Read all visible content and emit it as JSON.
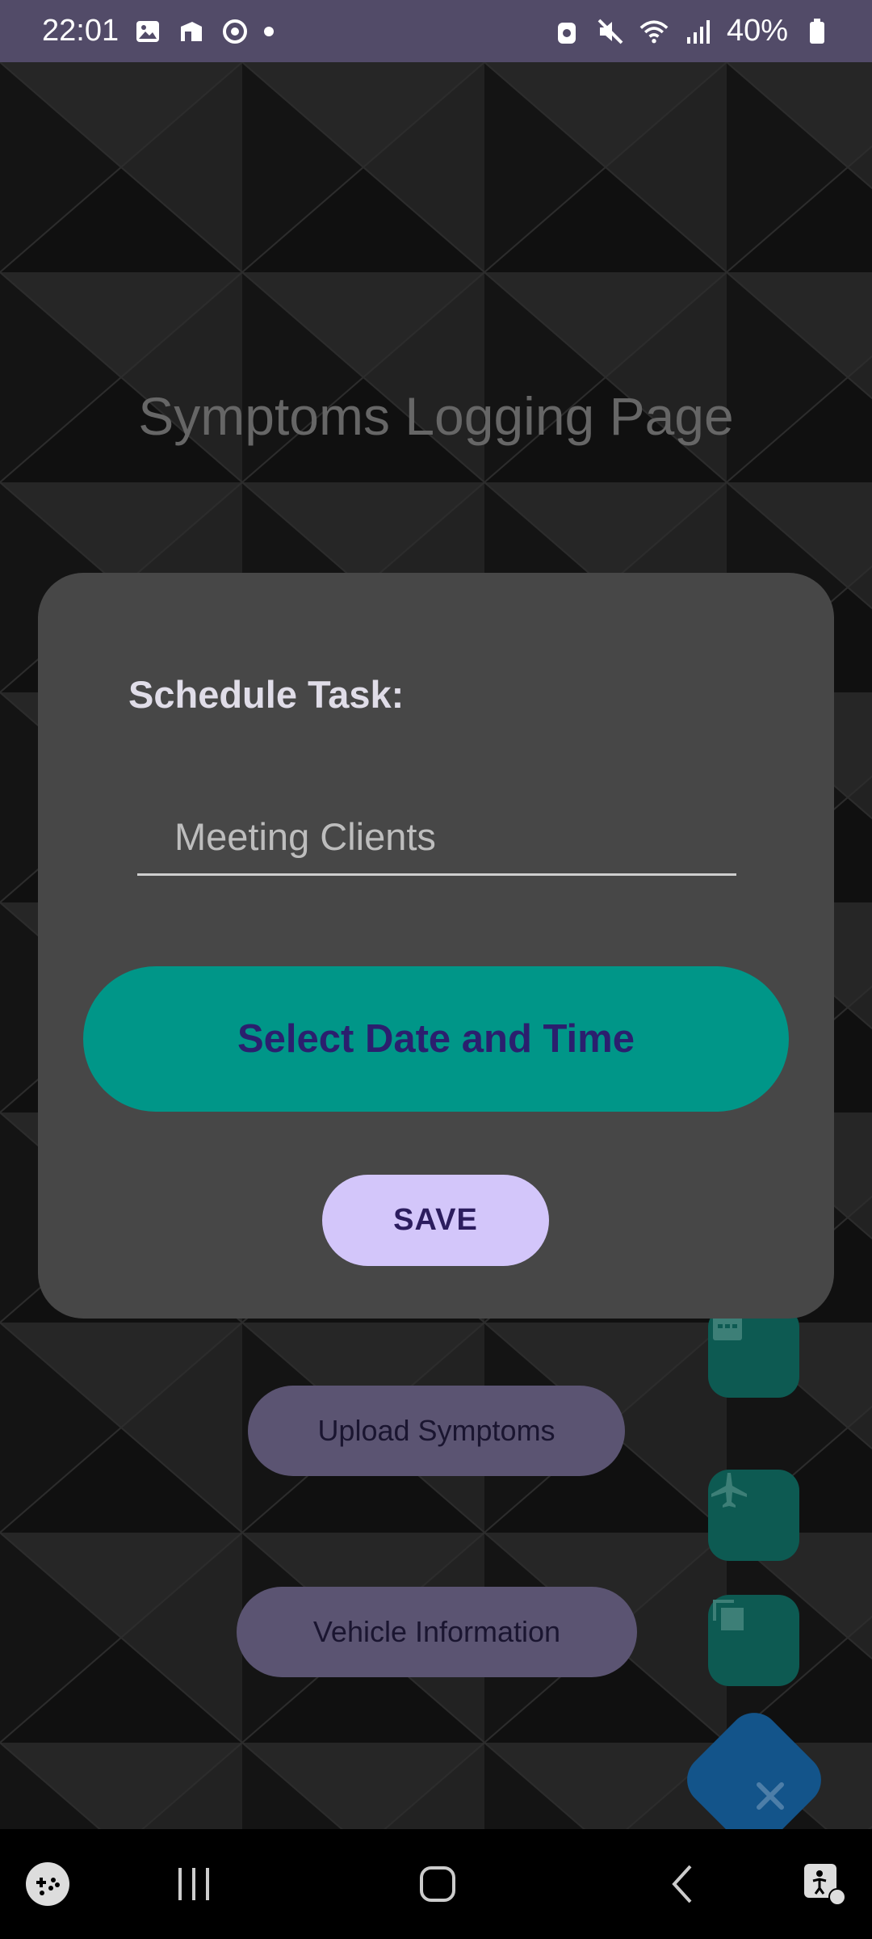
{
  "status_bar": {
    "time": "22:01",
    "battery": "40%",
    "left_icons": [
      "image-icon",
      "cast-icon",
      "screen-record-icon",
      "dot-icon"
    ],
    "right_icons": [
      "alarm-icon",
      "mute-icon",
      "wifi-icon",
      "signal-icon",
      "battery-icon"
    ]
  },
  "page": {
    "title": "Symptoms Logging Page",
    "buttons": {
      "upload_symptoms": "Upload Symptoms",
      "vehicle_information": "Vehicle Information"
    },
    "fab_icons": [
      "calendar-icon",
      "flight-icon",
      "copy-icon",
      "close-icon"
    ]
  },
  "dialog": {
    "title": "Schedule Task:",
    "task_input_value": "Meeting Clients",
    "select_datetime_label": "Select Date and Time",
    "save_label": "SAVE"
  },
  "colors": {
    "status_bar": "#524b68",
    "dialog_bg": "#474747",
    "accent_teal": "#009688",
    "save_button": "#d3c6fa",
    "fab_teal": "#0d5a52",
    "fab_blue": "#13548a"
  },
  "nav_bar": {
    "icons": [
      "game-launcher-icon",
      "recents-icon",
      "home-icon",
      "back-icon",
      "accessibility-icon"
    ]
  }
}
